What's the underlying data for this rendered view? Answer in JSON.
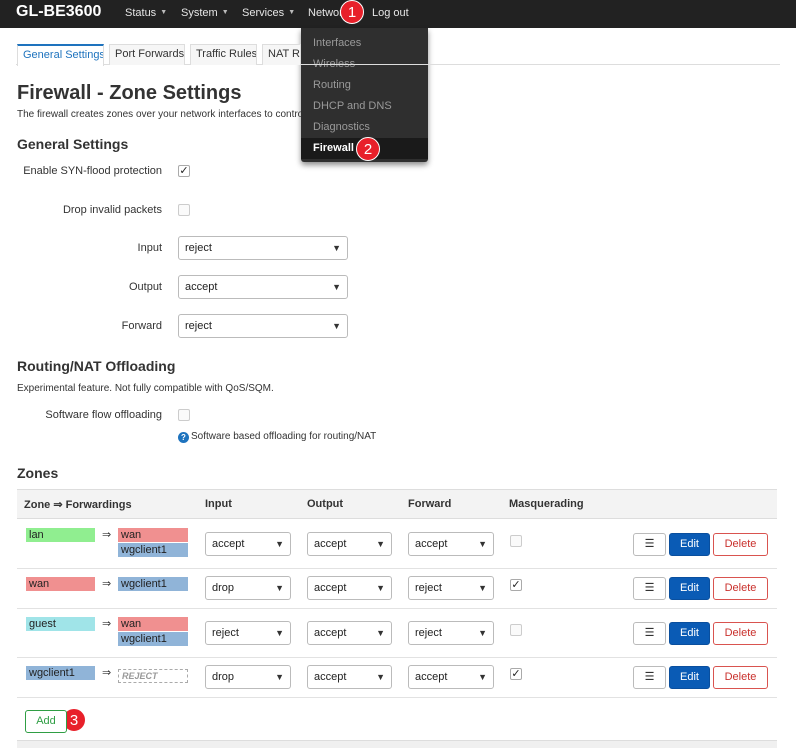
{
  "brand": "GL-BE3600",
  "nav": {
    "status": "Status",
    "system": "System",
    "services": "Services",
    "network": "Network",
    "logout": "Log out"
  },
  "network_menu": [
    "Interfaces",
    "Wireless",
    "Routing",
    "DHCP and DNS",
    "Diagnostics",
    "Firewall"
  ],
  "callouts": [
    "1",
    "2",
    "3"
  ],
  "tabs": [
    "General Settings",
    "Port Forwards",
    "Traffic Rules",
    "NAT Rules"
  ],
  "page": {
    "title": "Firewall - Zone Settings",
    "description": "The firewall creates zones over your network interfaces to control network traffic flow."
  },
  "general": {
    "heading": "General Settings",
    "syn_label": "Enable SYN-flood protection",
    "syn_checked": true,
    "drop_label": "Drop invalid packets",
    "drop_checked": false,
    "input_label": "Input",
    "input_value": "reject",
    "output_label": "Output",
    "output_value": "accept",
    "forward_label": "Forward",
    "forward_value": "reject"
  },
  "offload": {
    "heading": "Routing/NAT Offloading",
    "note": "Experimental feature. Not fully compatible with QoS/SQM.",
    "sw_label": "Software flow offloading",
    "sw_checked": false,
    "help": "Software based offloading for routing/NAT"
  },
  "zones": {
    "heading": "Zones",
    "headers": {
      "zone": "Zone ⇒ Forwardings",
      "input": "Input",
      "output": "Output",
      "forward": "Forward",
      "masq": "Masquerading"
    },
    "arrow": "⇒",
    "rows": [
      {
        "name": "lan",
        "name_color": "#90ee90",
        "dests": [
          "wan",
          "wgclient1"
        ],
        "input": "accept",
        "output": "accept",
        "forward": "accept",
        "masq": false
      },
      {
        "name": "wan",
        "name_color": "#f09090",
        "dests": [
          "wgclient1"
        ],
        "input": "drop",
        "output": "accept",
        "forward": "reject",
        "masq": true
      },
      {
        "name": "guest",
        "name_color": "#a0e4e8",
        "dests": [
          "wan",
          "wgclient1"
        ],
        "input": "reject",
        "output": "accept",
        "forward": "reject",
        "masq": false
      },
      {
        "name": "wgclient1",
        "name_color": "#90b4d8",
        "dests": [
          "REJECT"
        ],
        "input": "drop",
        "output": "accept",
        "forward": "accept",
        "masq": true
      }
    ],
    "menu_glyph": "☰",
    "edit_label": "Edit",
    "delete_label": "Delete",
    "add_label": "Add"
  },
  "colors": {
    "wan": "#f09090",
    "wgclient1": "#90b4d8",
    "lan": "#90ee90",
    "guest": "#a0e4e8",
    "accent": "#1e73be",
    "callout": "#e8202a"
  }
}
